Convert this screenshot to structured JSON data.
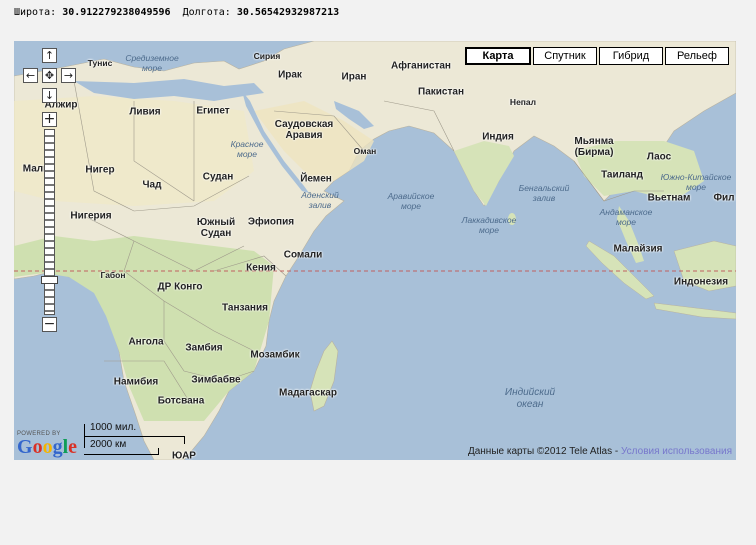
{
  "coords": {
    "lat_label": "Широта:",
    "lat_value": "30.912279238049596",
    "lon_label": "Долгота:",
    "lon_value": "30.56542932987213"
  },
  "map_types": [
    {
      "label": "Карта",
      "active": true
    },
    {
      "label": "Спутник",
      "active": false
    },
    {
      "label": "Гибрид",
      "active": false
    },
    {
      "label": "Рельеф",
      "active": false
    }
  ],
  "controls": {
    "pan_up": "↑",
    "pan_left": "←",
    "pan_center": "✥",
    "pan_right": "→",
    "pan_down": "↓",
    "zoom_in": "+",
    "zoom_out": "−"
  },
  "countries": {
    "tunis": "Тунис",
    "algeria": "Алжир",
    "libya": "Ливия",
    "egypt": "Египет",
    "syria": "Сирия",
    "iraq": "Ирак",
    "iran": "Иран",
    "afghanistan": "Афганистан",
    "pakistan": "Пакистан",
    "nepal": "Непал",
    "india": "Индия",
    "saudi": "Саудовская\nАравия",
    "oman": "Оман",
    "yemen": "Йемен",
    "mali": "Мали",
    "niger": "Нигер",
    "chad": "Чад",
    "sudan": "Судан",
    "south_sudan": "Южный\nСудан",
    "ethiopia": "Эфиопия",
    "somalia": "Сомали",
    "nigeria": "Нигерия",
    "gabon": "Габон",
    "drc": "ДР Конго",
    "kenya": "Кения",
    "tanzania": "Танзания",
    "angola": "Ангола",
    "zambia": "Замбия",
    "mozambique": "Мозамбик",
    "namibia": "Намибия",
    "zimbabwe": "Зимбабве",
    "botswana": "Ботсвана",
    "madagascar": "Мадагаскар",
    "sa": "ЮАР",
    "myanmar": "Мьянма\n(Бирма)",
    "laos": "Лаос",
    "thailand": "Таиланд",
    "vietnam": "Вьетнам",
    "philippines": "Фил",
    "malaysia": "Малайзия",
    "indonesia": "Индонезия"
  },
  "seas": {
    "mediterranean": "Средиземное\nморе",
    "red_sea": "Красное\nморе",
    "gulf_aden": "Аденский\nзалив",
    "arabian": "Аравийское\nморе",
    "laccadive": "Лаккадивское\nморе",
    "bengal": "Бенгальский\nзалив",
    "andaman": "Андаманское\nморе",
    "south_china": "Южно-Китайское\nморе",
    "indian_ocean": "Индийский\nокеан"
  },
  "scale": {
    "miles": "1000 мил.",
    "km": "2000 км"
  },
  "powered": {
    "small": "POWERED BY",
    "logo": "Google"
  },
  "google_colors": {
    "blue": "#3366cc",
    "red": "#d93025",
    "yellow": "#f4b400",
    "green": "#0f9d58"
  },
  "copyright": {
    "text": "Данные карты ©2012 Tele Atlas - ",
    "terms": "Условия использования"
  },
  "colors": {
    "water": "#a8c0d8",
    "land": "#f2efe4",
    "desert": "#e8e0c0",
    "green_land": "#cfe0b0",
    "equator": "#c06060"
  }
}
